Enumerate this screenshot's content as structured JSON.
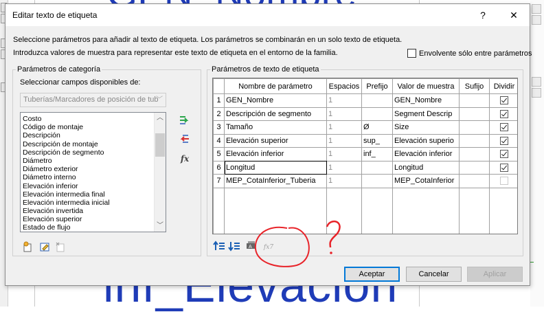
{
  "background": {
    "top_text": "GEN_Nombre",
    "bottom_text": "inf_Elevación"
  },
  "dialog": {
    "title": "Editar texto de etiqueta",
    "help_button": "?",
    "close_button": "✕",
    "intro_line1": "Seleccione parámetros para añadir al texto de etiqueta. Los parámetros se combinarán en un solo texto de etiqueta.",
    "intro_line2": "Introduzca valores de muestra para representar este texto de etiqueta en el entorno de la familia.",
    "wrap_checkbox_label": "Envolvente sólo entre parámetros",
    "wrap_checkbox_checked": false
  },
  "category_panel": {
    "legend": "Parámetros de categoría",
    "select_label": "Seleccionar campos disponibles de:",
    "combo_value": "Tuberías/Marcadores de posición de tub",
    "fields": [
      "Costo",
      "Código de montaje",
      "Descripción",
      "Descripción de montaje",
      "Descripción de segmento",
      "Diámetro",
      "Diámetro exterior",
      "Diámetro interno",
      "Elevación inferior",
      "Elevación intermedia final",
      "Elevación intermedia inicial",
      "Elevación invertida",
      "Elevación superior",
      "Estado de flujo"
    ]
  },
  "label_panel": {
    "legend": "Parámetros de texto de etiqueta",
    "columns": [
      "",
      "Nombre de parámetro",
      "Espacios",
      "Prefijo",
      "Valor de muestra",
      "Sufijo",
      "Dividir"
    ],
    "rows": [
      {
        "n": "1",
        "name": "GEN_Nombre",
        "spaces": "1",
        "prefix": "",
        "sample": "GEN_Nombre",
        "suffix": "",
        "split": true,
        "split_enabled": true
      },
      {
        "n": "2",
        "name": "Descripción de segmento",
        "spaces": "1",
        "prefix": "",
        "sample": "Segment Descrip",
        "suffix": "",
        "split": true,
        "split_enabled": true
      },
      {
        "n": "3",
        "name": "Tamaño",
        "spaces": "1",
        "prefix": "Ø",
        "sample": "Size",
        "suffix": "",
        "split": true,
        "split_enabled": true
      },
      {
        "n": "4",
        "name": "Elevación superior",
        "spaces": "1",
        "prefix": "sup_",
        "sample": "Elevación superio",
        "suffix": "",
        "split": true,
        "split_enabled": true
      },
      {
        "n": "5",
        "name": "Elevación inferior",
        "spaces": "1",
        "prefix": "inf_",
        "sample": "Elevación inferior",
        "suffix": "",
        "split": true,
        "split_enabled": true
      },
      {
        "n": "6",
        "name": "Longitud",
        "spaces": "1",
        "prefix": "",
        "sample": "Longitud",
        "suffix": "",
        "split": true,
        "split_enabled": true
      },
      {
        "n": "7",
        "name": "MEP_CotaInferior_Tuberia",
        "spaces": "1",
        "prefix": "",
        "sample": "MEP_CotaInferior",
        "suffix": "",
        "split": false,
        "split_enabled": false
      }
    ]
  },
  "icons": {
    "add_param": "arrow-right-green-icon",
    "remove_param": "arrow-left-red-icon",
    "fx_add": "fx",
    "fx_edit": "fx7"
  },
  "annotation": {
    "question_mark": "?"
  },
  "buttons": {
    "ok": "Aceptar",
    "cancel": "Cancelar",
    "apply": "Aplicar"
  },
  "colors": {
    "accent_blue": "#0078d7",
    "annotation_red": "#e8242a",
    "canvas_text_blue": "#1f3cb8"
  }
}
